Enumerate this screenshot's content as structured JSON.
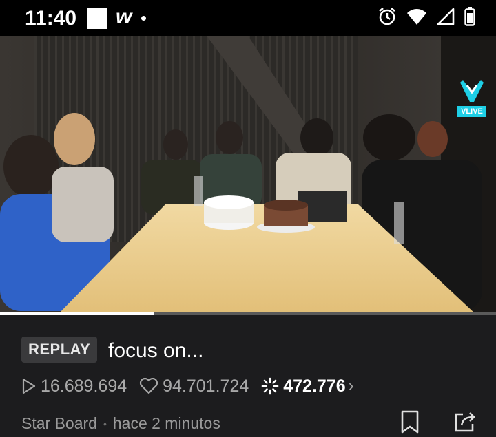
{
  "status_bar": {
    "time": "11:40",
    "app_glyph": "w",
    "icons": [
      "alarm-icon",
      "wifi-icon",
      "signal-icon",
      "battery-icon"
    ]
  },
  "player": {
    "watermark_text": "VLIVE",
    "progress_fraction": 0.31
  },
  "video": {
    "badge": "REPLAY",
    "title": "focus on...",
    "plays": "16.689.694",
    "likes": "94.701.724",
    "comments": "472.776",
    "channel": "Star Board",
    "separator": "•",
    "time_ago": "hace 2 minutos"
  },
  "colors": {
    "background": "#1c1c1e",
    "badge_bg": "#3a3a3c",
    "vlive_accent": "#1ecfe6"
  }
}
